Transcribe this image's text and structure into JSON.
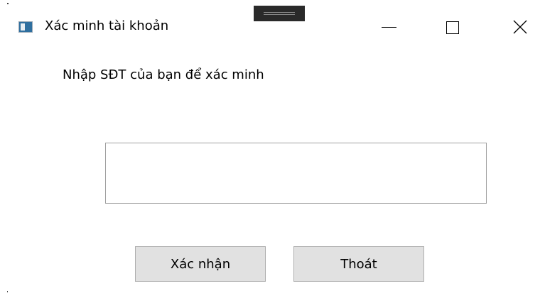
{
  "window": {
    "title": "Xác minh tài khoản",
    "icon": "app-window-icon"
  },
  "caption_buttons": {
    "minimize_icon": "minimize-icon",
    "maximize_icon": "maximize-icon",
    "close_icon": "close-icon"
  },
  "form": {
    "prompt": "Nhập SĐT của bạn để xác minh",
    "phone_input": {
      "value": "",
      "placeholder": ""
    },
    "confirm_label": "Xác nhận",
    "exit_label": "Thoát"
  },
  "colors": {
    "button_face": "#e1e1e1",
    "button_border": "#adadad",
    "input_border": "#a0a0a0",
    "background": "#ffffff"
  }
}
